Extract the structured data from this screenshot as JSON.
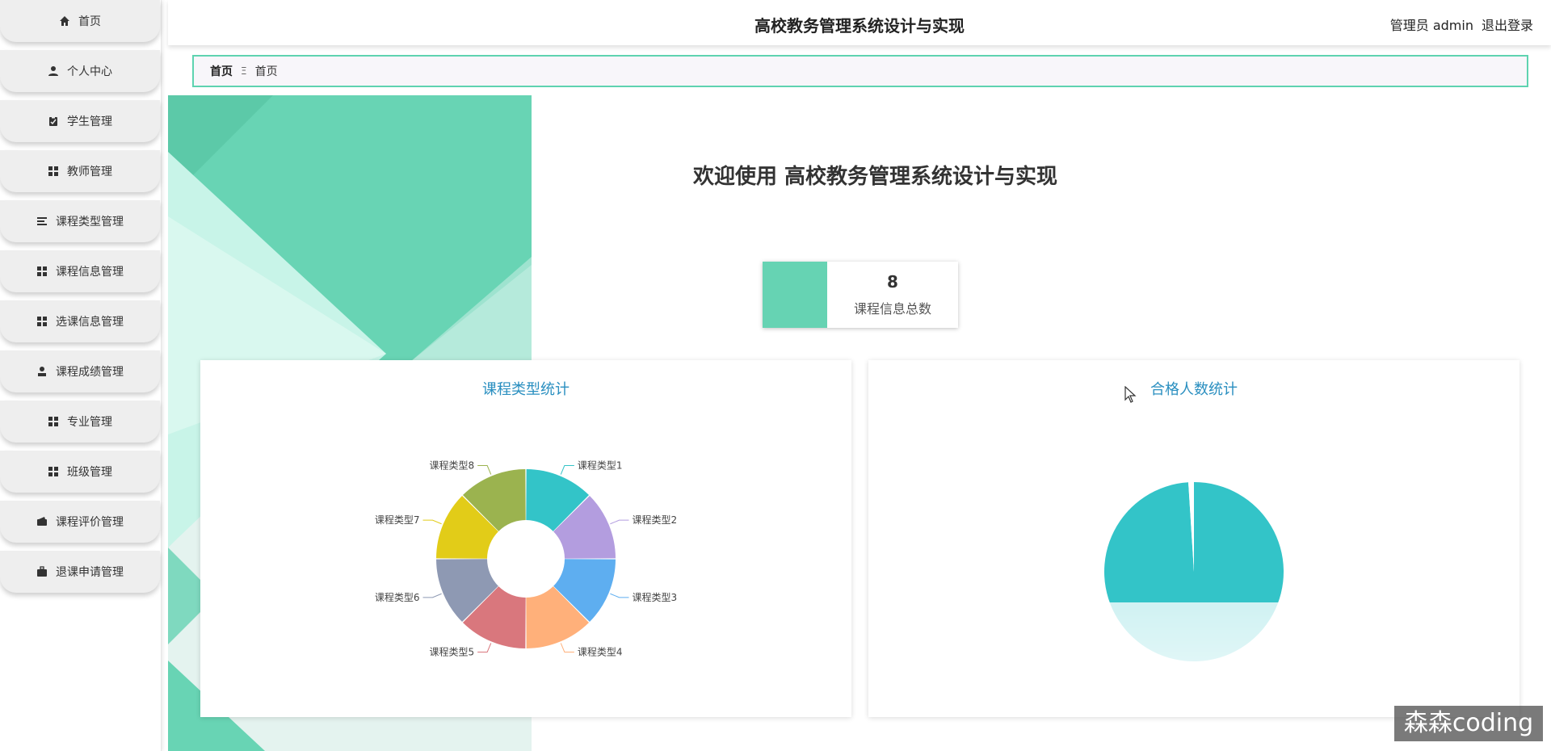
{
  "header": {
    "app_title": "高校教务管理系统设计与实现",
    "user_label": "管理员 admin",
    "logout_label": "退出登录"
  },
  "sidebar": {
    "items": [
      {
        "label": "首页",
        "icon": "home-icon"
      },
      {
        "label": "个人中心",
        "icon": "person-icon"
      },
      {
        "label": "学生管理",
        "icon": "clipboard-icon"
      },
      {
        "label": "教师管理",
        "icon": "grid-icon"
      },
      {
        "label": "课程类型管理",
        "icon": "list-icon"
      },
      {
        "label": "课程信息管理",
        "icon": "grid-icon"
      },
      {
        "label": "选课信息管理",
        "icon": "grid-icon"
      },
      {
        "label": "课程成绩管理",
        "icon": "user-icon"
      },
      {
        "label": "专业管理",
        "icon": "grid-icon"
      },
      {
        "label": "班级管理",
        "icon": "grid-icon"
      },
      {
        "label": "课程评价管理",
        "icon": "wallet-icon"
      },
      {
        "label": "退课申请管理",
        "icon": "briefcase-icon"
      }
    ]
  },
  "breadcrumb": {
    "home": "首页",
    "separator": "Ξ",
    "current": "首页"
  },
  "main": {
    "welcome": "欢迎使用 高校教务管理系统设计与实现",
    "stat": {
      "value": "8",
      "label": "课程信息总数",
      "color": "#66d3b3"
    }
  },
  "colors": {
    "accent": "#66d3b3",
    "title_blue": "#2a8fc0"
  },
  "chart_data": [
    {
      "type": "pie",
      "variant": "donut",
      "title": "课程类型统计",
      "categories": [
        "课程类型1",
        "课程类型2",
        "课程类型3",
        "课程类型4",
        "课程类型5",
        "课程类型6",
        "课程类型7",
        "课程类型8"
      ],
      "values": [
        1,
        1,
        1,
        1,
        1,
        1,
        1,
        1
      ],
      "colors": [
        "#33c4c8",
        "#b39ddf",
        "#5eaef0",
        "#ffb07a",
        "#d9777d",
        "#8e99b3",
        "#e2cc18",
        "#9bb34f"
      ]
    },
    {
      "type": "pie",
      "title": "合格人数统计",
      "categories": [
        "",
        ""
      ],
      "values": [
        99,
        1
      ],
      "colors": [
        "#33c4c8",
        "#ffffff"
      ]
    }
  ],
  "watermark": "森森coding"
}
